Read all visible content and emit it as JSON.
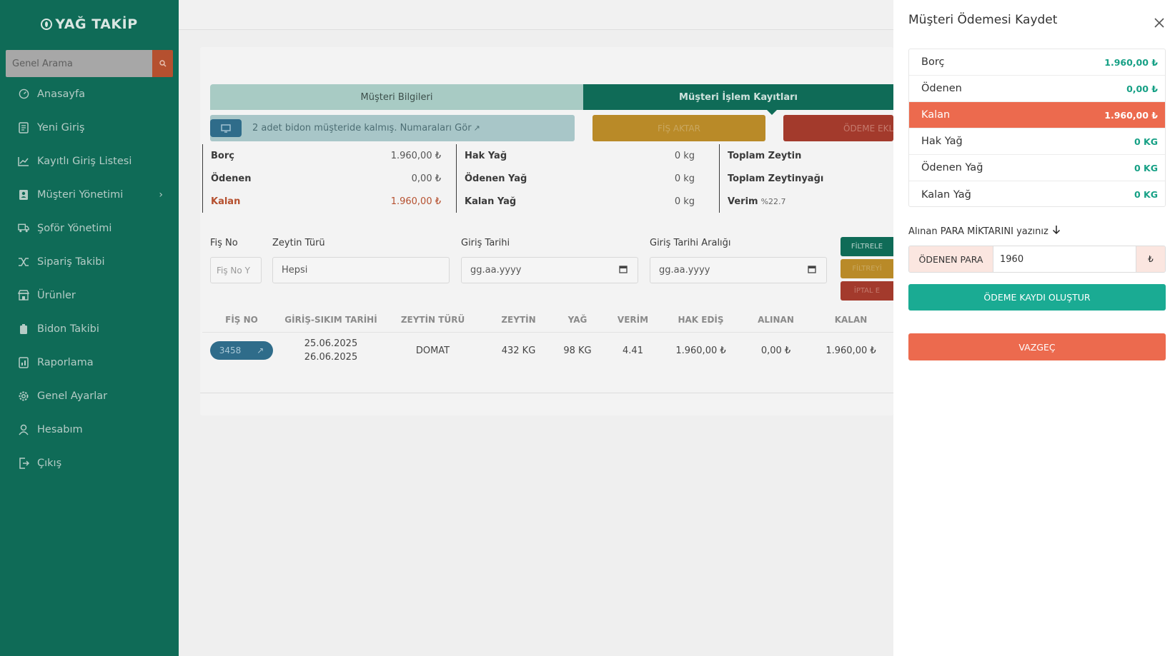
{
  "app": {
    "logo_text": "YAĞ TAKİP"
  },
  "sidebar": {
    "search_placeholder": "Genel Arama",
    "items": [
      {
        "label": "Anasayfa",
        "icon": "dashboard-icon"
      },
      {
        "label": "Yeni Giriş",
        "icon": "document-icon"
      },
      {
        "label": "Kayıtlı Giriş Listesi",
        "icon": "chart-line-icon"
      },
      {
        "label": "Müşteri Yönetimi",
        "icon": "contacts-icon",
        "has_submenu": true
      },
      {
        "label": "Şoför Yönetimi",
        "icon": "truck-icon"
      },
      {
        "label": "Sipariş Takibi",
        "icon": "shuffle-icon"
      },
      {
        "label": "Ürünler",
        "icon": "store-icon"
      },
      {
        "label": "Bidon Takibi",
        "icon": "barrel-icon"
      },
      {
        "label": "Raporlama",
        "icon": "report-icon"
      },
      {
        "label": "Genel Ayarlar",
        "icon": "gear-icon"
      },
      {
        "label": "Hesabım",
        "icon": "user-icon"
      },
      {
        "label": "Çıkış",
        "icon": "logout-icon"
      }
    ]
  },
  "main": {
    "tabs": [
      {
        "label": "Müşteri Bilgileri",
        "active": false
      },
      {
        "label": "Müşteri İşlem Kayıtları",
        "active": true
      }
    ],
    "notice": "2 adet bidon müşteride kalmış. Numaraları Gör",
    "fis_aktar_label": "FİŞ AKTAR",
    "odeme_ekle_label": "ÖDEME EKLE",
    "summary": {
      "col1": [
        {
          "label": "Borç",
          "value": "1.960,00 ₺"
        },
        {
          "label": "Ödenen",
          "value": "0,00 ₺"
        },
        {
          "label": "Kalan",
          "value": "1.960,00 ₺"
        }
      ],
      "col2": [
        {
          "label": "Hak Yağ",
          "value": "0 kg"
        },
        {
          "label": "Ödenen Yağ",
          "value": "0 kg"
        },
        {
          "label": "Kalan Yağ",
          "value": "0 kg"
        }
      ],
      "col3": [
        {
          "label": "Toplam Zeytin",
          "value": ""
        },
        {
          "label": "Toplam Zeytinyağı",
          "value": ""
        },
        {
          "label": "Verim",
          "value": "%22.7"
        }
      ]
    },
    "filters": {
      "fis_no_label": "Fiş No",
      "fis_no_placeholder": "Fiş No Y",
      "zeytin_turu_label": "Zeytin Türü",
      "zeytin_turu_value": "Hepsi",
      "giris_tarihi_label": "Giriş Tarihi",
      "giris_tarihi_placeholder": "gg.aa.yyyy",
      "giris_araligi_label": "Giriş Tarihi Aralığı",
      "giris_araligi_placeholder": "gg.aa.yyyy",
      "btn_filtrele": "FİLTRELE",
      "btn_filtreyi": "FİLTREYİ",
      "btn_iptal": "İPTAL E"
    },
    "table": {
      "headers": [
        "FİŞ NO",
        "GİRİŞ-SIKIM TARİHİ",
        "ZEYTİN TÜRÜ",
        "ZEYTİN",
        "YAĞ",
        "VERİM",
        "HAK EDİŞ",
        "ALINAN",
        "KALAN"
      ],
      "rows": [
        {
          "fis_no": "3458",
          "giris_tarihi": "25.06.2025",
          "sikim_tarihi": "26.06.2025",
          "zeytin_turu": "DOMAT",
          "zeytin": "432 KG",
          "yag": "98 KG",
          "verim": "4.41",
          "hak_edis": "1.960,00 ₺",
          "alinan": "0,00 ₺",
          "kalan": "1.960,00 ₺"
        }
      ]
    }
  },
  "drawer": {
    "title": "Müşteri Ödemesi Kaydet",
    "info_rows": [
      {
        "label": "Borç",
        "value": "1.960,00 ₺"
      },
      {
        "label": "Ödenen",
        "value": "0,00 ₺"
      },
      {
        "label": "Kalan",
        "value": "1.960,00 ₺"
      },
      {
        "label": "Hak Yağ",
        "value": "0 KG"
      },
      {
        "label": "Ödenen Yağ",
        "value": "0 KG"
      },
      {
        "label": "Kalan Yağ",
        "value": "0 KG"
      }
    ],
    "amount_label": "Alınan PARA MİKTARINI yazınız",
    "amount_prefix": "ÖDENEN PARA",
    "amount_value": "1960",
    "amount_suffix": "₺",
    "create_button": "ÖDEME KAYDI OLUŞTUR",
    "cancel_button": "VAZGEÇ"
  },
  "colors": {
    "sidebar": "#0f6b57",
    "teal_button": "#1aab93",
    "red_button": "#ec6a4e",
    "value_green": "#16a085"
  }
}
